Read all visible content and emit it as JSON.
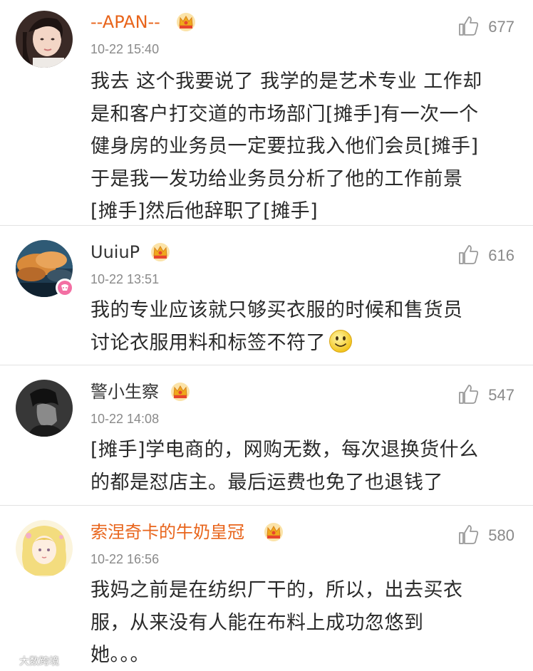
{
  "colors": {
    "username_orange": "#e8641b",
    "username_dark": "#333333",
    "time_gray": "#8a8a8a",
    "text": "#2a2a2a",
    "crown_gold": "#f5a623"
  },
  "comments": [
    {
      "username": "--APAN--",
      "time": "10-22 15:40",
      "likes": "677",
      "badge": "vip-crown-icon",
      "lines": [
        "我去 这个我要说了 我学的是艺术专业 工作却",
        "是和客户打交道的市场部门[摊手]有一次一个",
        "健身房的业务员一定要拉我入他们会员[摊手]",
        "于是我一发功给业务员分析了他的工作前景",
        "[摊手]然后他辞职了[摊手]"
      ]
    },
    {
      "username": "UuiuP",
      "time": "10-22 13:51",
      "likes": "616",
      "badge": "vip-crown-icon",
      "lines": [
        "我的专业应该就只够买衣服的时候和售货员",
        "讨论衣服用料和标签不符了"
      ],
      "emoji": "smiley-face-icon"
    },
    {
      "username": "警小生察",
      "time": "10-22 14:08",
      "likes": "547",
      "badge": "vip-crown-icon",
      "lines": [
        "[摊手]学电商的，网购无数，每次退换货什么",
        "的都是怼店主。最后运费也免了也退钱了"
      ]
    },
    {
      "username": "索涅奇卡的牛奶皇冠",
      "time": "10-22 16:56",
      "likes": "580",
      "badge": "vip-crown-icon",
      "lines": [
        "我妈之前是在纺织厂干的，所以，出去买衣",
        "服，从来没有人能在布料上成功忽悠到",
        "她。。。"
      ]
    }
  ],
  "watermark": "大数跨境"
}
